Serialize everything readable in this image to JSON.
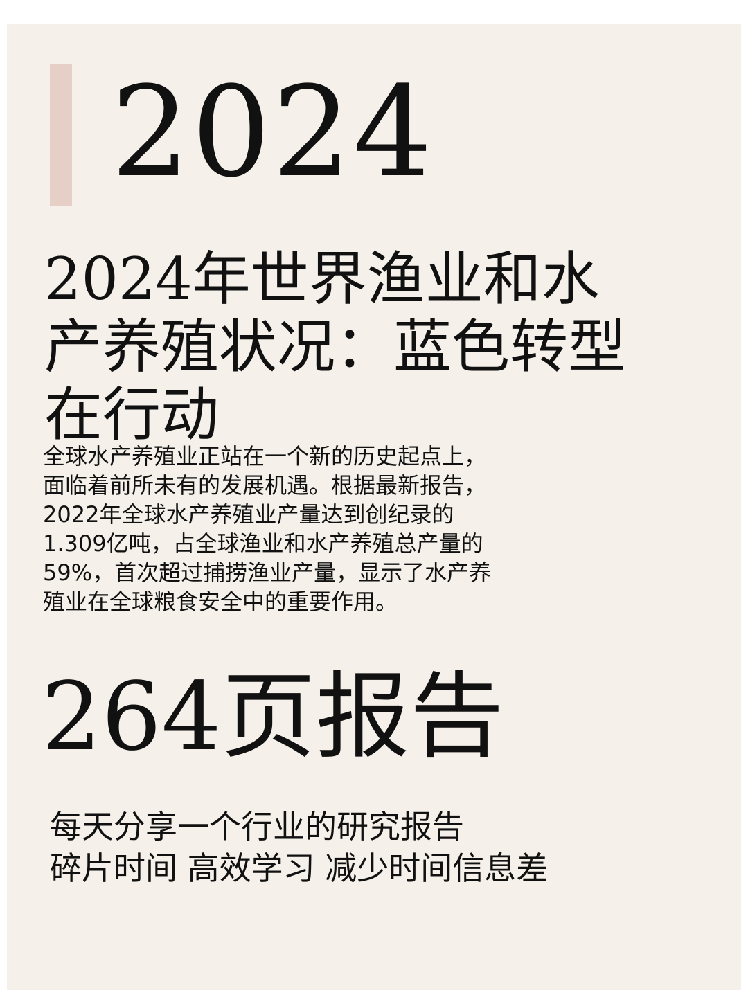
{
  "colors": {
    "page_background": "#ffffff",
    "card_background": "#f5f1ea",
    "accent_bar": "#e6cfc7",
    "text": "#111111"
  },
  "hero": {
    "year": "2024"
  },
  "title": "2024年世界渔业和水产养殖状况：蓝色转型在行动",
  "body": "全球水产养殖业正站在一个新的历史起点上，\n面临着前所未有的发展机遇。根据最新报告，\n2022年全球水产养殖业产量达到创纪录的\n1.309亿吨，占全球渔业和水产养殖总产量的\n59%，首次超过捕捞渔业产量，显示了水产养\n殖业在全球粮食安全中的重要作用。",
  "pages_label": "264页报告",
  "tagline": {
    "line1": "每天分享一个行业的研究报告",
    "line2": "碎片时间 高效学习 减少时间信息差"
  }
}
